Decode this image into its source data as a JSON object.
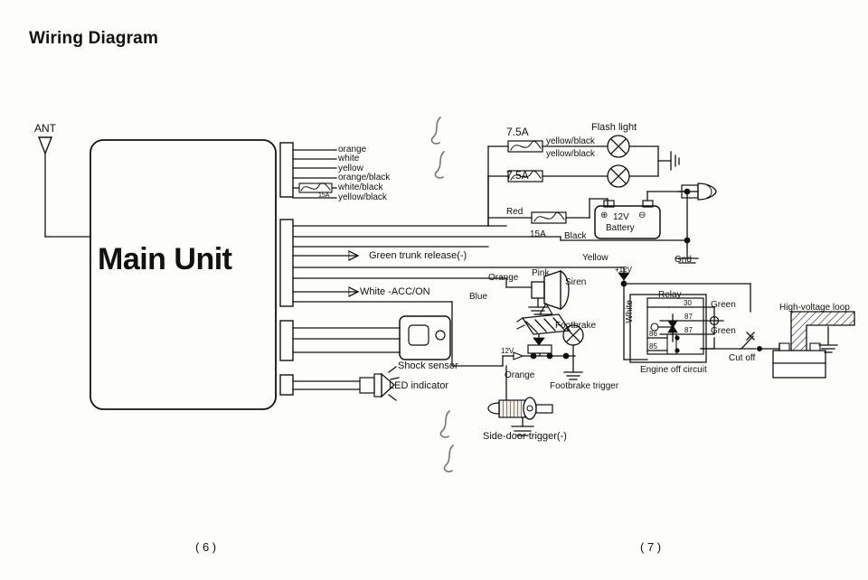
{
  "page": {
    "title": "Wiring Diagram",
    "page_left": "( 6 )",
    "page_right": "( 7 )",
    "background": "#fdfdfb",
    "ink": "#111111"
  },
  "main_unit": {
    "label": "Main Unit",
    "antenna_label": "ANT"
  },
  "harness": {
    "connector_top_wires": [
      {
        "label": "orange"
      },
      {
        "label": "white"
      },
      {
        "label": "yellow"
      },
      {
        "label": "orange/black"
      },
      {
        "label": "white/black",
        "fuse": "15A"
      },
      {
        "label": "yellow/black"
      }
    ],
    "connector_mid_wires": [
      {
        "label": "Green trunk release(-)"
      },
      {
        "label": "White -ACC/ON"
      }
    ]
  },
  "fuses": {
    "flash_top": "7.5A",
    "flash_bottom": "7.5A",
    "power": "15A",
    "inline_harness": "15A"
  },
  "flash_lights": {
    "title": "Flash light",
    "wire_top": "yellow/black",
    "wire_bottom": "yellow/black"
  },
  "battery": {
    "plus": "⊕",
    "voltage": "12V",
    "name": "Battery",
    "minus": "⊖",
    "wire_positive": "Red",
    "wire_negative": "Black",
    "ground_label": "Gnd"
  },
  "siren": {
    "name": "Siren",
    "wire_pink": "Pink",
    "wire_orange": "Orange",
    "wire_yellow": "Yellow",
    "wire_blue": "Blue"
  },
  "sensors": {
    "shock_sensor": "Shock sensor",
    "led_indicator": "LED indicator"
  },
  "footbrake": {
    "pedal_label": "Footbrake",
    "supply": "12V",
    "wire": "Orange",
    "trigger_label": "Footbrake trigger"
  },
  "side_door": {
    "label": "Side-door  trigger(-)"
  },
  "relay": {
    "title": "Relay",
    "terminals": {
      "t30": "30",
      "t87": "87",
      "t87a": "87",
      "t86": "86",
      "t85": "85"
    },
    "wire_white": "White",
    "wire_green_top": "Green",
    "wire_green_bottom": "Green",
    "circuit_label": "Engine off circuit",
    "cut_off_label": "Cut off",
    "supply_label": "+12V"
  },
  "ignition": {
    "high_voltage_loop": "High-voltage loop"
  }
}
